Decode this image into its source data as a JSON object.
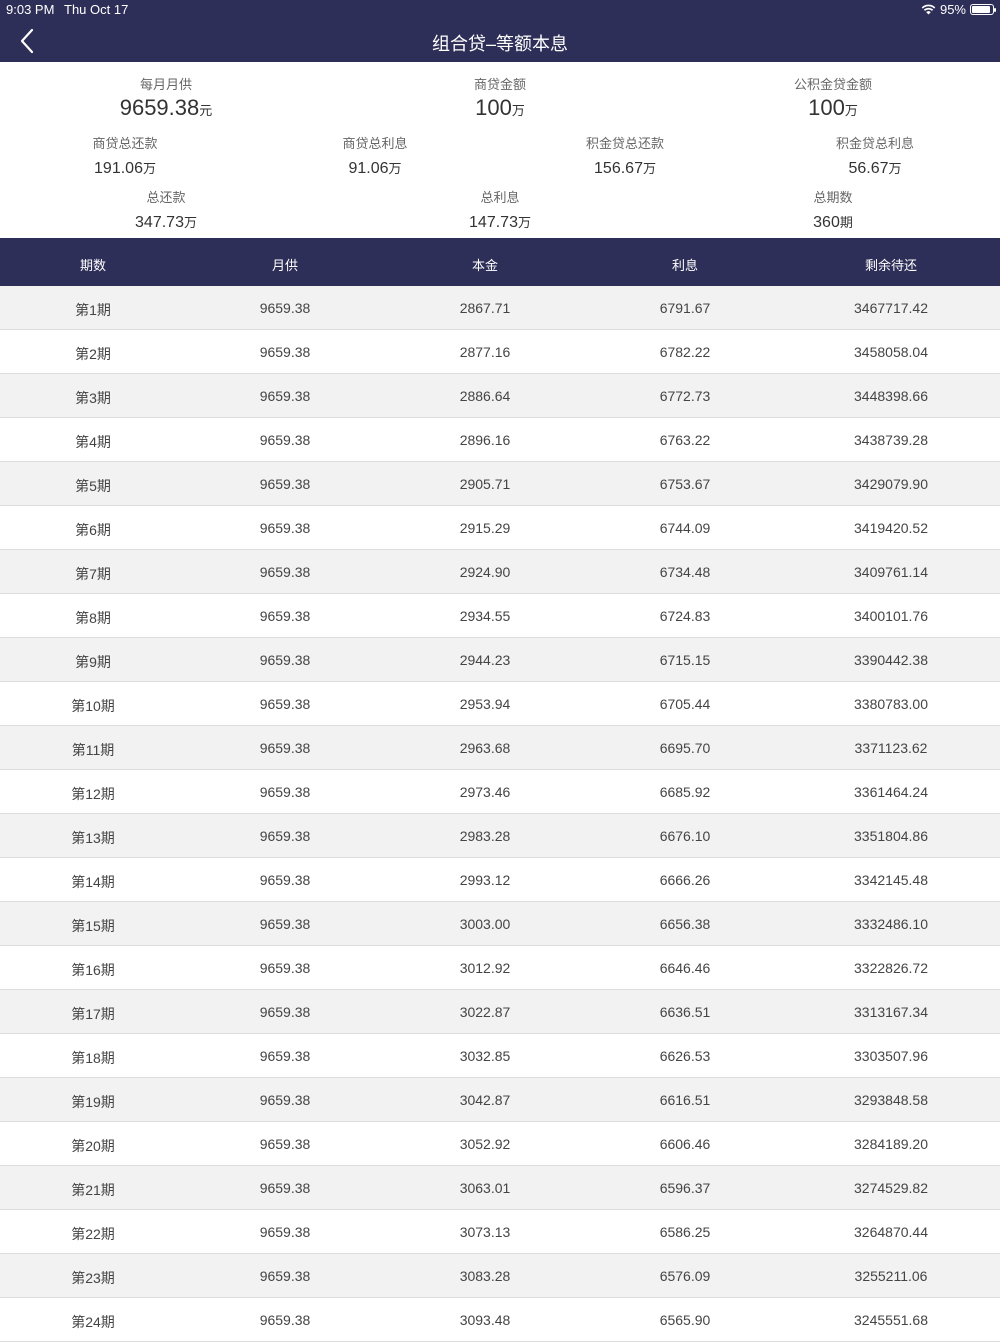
{
  "status_bar": {
    "time": "9:03 PM",
    "date": "Thu Oct 17",
    "battery": "95%"
  },
  "nav": {
    "title": "组合贷–等额本息",
    "back_icon": "chevron-left-icon"
  },
  "summary": {
    "monthly_payment": {
      "label": "每月月供",
      "value": "9659.38",
      "unit": "元"
    },
    "commercial_amount": {
      "label": "商贷金额",
      "value": "100",
      "unit": "万"
    },
    "fund_amount": {
      "label": "公积金贷金额",
      "value": "100",
      "unit": "万"
    },
    "commercial_total_repay": {
      "label": "商贷总还款",
      "value": "191.06",
      "unit": "万"
    },
    "commercial_total_interest": {
      "label": "商贷总利息",
      "value": "91.06",
      "unit": "万"
    },
    "fund_total_repay": {
      "label": "积金贷总还款",
      "value": "156.67",
      "unit": "万"
    },
    "fund_total_interest": {
      "label": "积金贷总利息",
      "value": "56.67",
      "unit": "万"
    },
    "total_repay": {
      "label": "总还款",
      "value": "347.73",
      "unit": "万"
    },
    "total_interest": {
      "label": "总利息",
      "value": "147.73",
      "unit": "万"
    },
    "total_periods": {
      "label": "总期数",
      "value": "360",
      "unit": "期"
    }
  },
  "table": {
    "headers": [
      "期数",
      "月供",
      "本金",
      "利息",
      "剩余待还"
    ],
    "rows": [
      [
        "第1期",
        "9659.38",
        "2867.71",
        "6791.67",
        "3467717.42"
      ],
      [
        "第2期",
        "9659.38",
        "2877.16",
        "6782.22",
        "3458058.04"
      ],
      [
        "第3期",
        "9659.38",
        "2886.64",
        "6772.73",
        "3448398.66"
      ],
      [
        "第4期",
        "9659.38",
        "2896.16",
        "6763.22",
        "3438739.28"
      ],
      [
        "第5期",
        "9659.38",
        "2905.71",
        "6753.67",
        "3429079.90"
      ],
      [
        "第6期",
        "9659.38",
        "2915.29",
        "6744.09",
        "3419420.52"
      ],
      [
        "第7期",
        "9659.38",
        "2924.90",
        "6734.48",
        "3409761.14"
      ],
      [
        "第8期",
        "9659.38",
        "2934.55",
        "6724.83",
        "3400101.76"
      ],
      [
        "第9期",
        "9659.38",
        "2944.23",
        "6715.15",
        "3390442.38"
      ],
      [
        "第10期",
        "9659.38",
        "2953.94",
        "6705.44",
        "3380783.00"
      ],
      [
        "第11期",
        "9659.38",
        "2963.68",
        "6695.70",
        "3371123.62"
      ],
      [
        "第12期",
        "9659.38",
        "2973.46",
        "6685.92",
        "3361464.24"
      ],
      [
        "第13期",
        "9659.38",
        "2983.28",
        "6676.10",
        "3351804.86"
      ],
      [
        "第14期",
        "9659.38",
        "2993.12",
        "6666.26",
        "3342145.48"
      ],
      [
        "第15期",
        "9659.38",
        "3003.00",
        "6656.38",
        "3332486.10"
      ],
      [
        "第16期",
        "9659.38",
        "3012.92",
        "6646.46",
        "3322826.72"
      ],
      [
        "第17期",
        "9659.38",
        "3022.87",
        "6636.51",
        "3313167.34"
      ],
      [
        "第18期",
        "9659.38",
        "3032.85",
        "6626.53",
        "3303507.96"
      ],
      [
        "第19期",
        "9659.38",
        "3042.87",
        "6616.51",
        "3293848.58"
      ],
      [
        "第20期",
        "9659.38",
        "3052.92",
        "6606.46",
        "3284189.20"
      ],
      [
        "第21期",
        "9659.38",
        "3063.01",
        "6596.37",
        "3274529.82"
      ],
      [
        "第22期",
        "9659.38",
        "3073.13",
        "6586.25",
        "3264870.44"
      ],
      [
        "第23期",
        "9659.38",
        "3083.28",
        "6576.09",
        "3255211.06"
      ],
      [
        "第24期",
        "9659.38",
        "3093.48",
        "6565.90",
        "3245551.68"
      ]
    ]
  }
}
